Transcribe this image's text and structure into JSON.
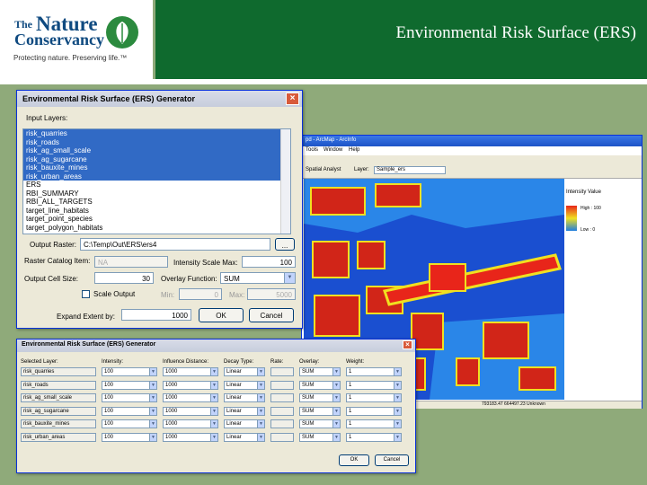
{
  "header": {
    "title": "Environmental Risk Surface (ERS)",
    "logo_the": "The",
    "logo_nature": "Nature",
    "logo_conservancy": "Conservancy",
    "logo_tagline": "Protecting nature. Preserving life.™"
  },
  "generator": {
    "title": "Environmental Risk Surface (ERS) Generator",
    "input_layers_label": "Input Layers:",
    "layers": [
      {
        "name": "risk_quarries",
        "selected": true
      },
      {
        "name": "risk_roads",
        "selected": true
      },
      {
        "name": "risk_ag_small_scale",
        "selected": true
      },
      {
        "name": "risk_ag_sugarcane",
        "selected": true
      },
      {
        "name": "risk_bauxite_mines",
        "selected": true
      },
      {
        "name": "risk_urban_areas",
        "selected": true
      },
      {
        "name": "ERS",
        "selected": false
      },
      {
        "name": "RBI_SUMMARY",
        "selected": false
      },
      {
        "name": "RBI_ALL_TARGETS",
        "selected": false
      },
      {
        "name": "target_line_habitats",
        "selected": false
      },
      {
        "name": "target_point_species",
        "selected": false
      },
      {
        "name": "target_polygon_habitats",
        "selected": false
      }
    ],
    "output_raster_label": "Output Raster:",
    "output_raster_value": "C:\\Temp\\Out\\ERS\\ers4",
    "browse_label": "...",
    "catalog_label": "Raster Catalog Item:",
    "catalog_value": "NA",
    "intensity_max_label": "Intensity Scale Max:",
    "intensity_max_value": "100",
    "cell_size_label": "Output Cell Size:",
    "cell_size_value": "30",
    "overlay_label": "Overlay Function:",
    "overlay_value": "SUM",
    "scale_output_label": "Scale Output",
    "min_label": "Min:",
    "min_value": "0",
    "max_label": "Max:",
    "max_value": "5000",
    "expand_label": "Expand Extent by:",
    "expand_value": "1000",
    "ok_label": "OK",
    "cancel_label": "Cancel"
  },
  "arcmap": {
    "title": "pd - ArcMap - ArcInfo",
    "menus": [
      "Tools",
      "Window",
      "Help"
    ],
    "spatial_analyst_label": "Spatial Analyst",
    "layer_label": "Layer:",
    "layer_value": "Sample_ers",
    "legend_title": "Intensity Value",
    "legend_high": "High : 100",
    "legend_low": "Low : 0",
    "status_text": "793183.47 664497.23 Unknown",
    "colors": {
      "water": "#1f7de0",
      "land": "#1a4fd0",
      "high": "#e8251a",
      "mid": "#f0e020"
    }
  },
  "weights": {
    "title": "Environmental Risk Surface (ERS) Generator",
    "headers": [
      "Selected Layer:",
      "Intensity:",
      "Influence Distance:",
      "Decay Type:",
      "Rate:",
      "Overlay:",
      "Weight:"
    ],
    "rows": [
      {
        "layer": "risk_quarries",
        "intensity": "100",
        "distance": "1000",
        "decay": "Linear",
        "rate": "",
        "overlay": "SUM",
        "weight": "1"
      },
      {
        "layer": "risk_roads",
        "intensity": "100",
        "distance": "1000",
        "decay": "Linear",
        "rate": "",
        "overlay": "SUM",
        "weight": "1"
      },
      {
        "layer": "risk_ag_small_scale",
        "intensity": "100",
        "distance": "1000",
        "decay": "Linear",
        "rate": "",
        "overlay": "SUM",
        "weight": "1"
      },
      {
        "layer": "risk_ag_sugarcane",
        "intensity": "100",
        "distance": "1000",
        "decay": "Linear",
        "rate": "",
        "overlay": "SUM",
        "weight": "1"
      },
      {
        "layer": "risk_bauxite_mines",
        "intensity": "100",
        "distance": "1000",
        "decay": "Linear",
        "rate": "",
        "overlay": "SUM",
        "weight": "1"
      },
      {
        "layer": "risk_urban_areas",
        "intensity": "100",
        "distance": "1000",
        "decay": "Linear",
        "rate": "",
        "overlay": "SUM",
        "weight": "1"
      }
    ],
    "ok_label": "OK",
    "cancel_label": "Cancel"
  }
}
